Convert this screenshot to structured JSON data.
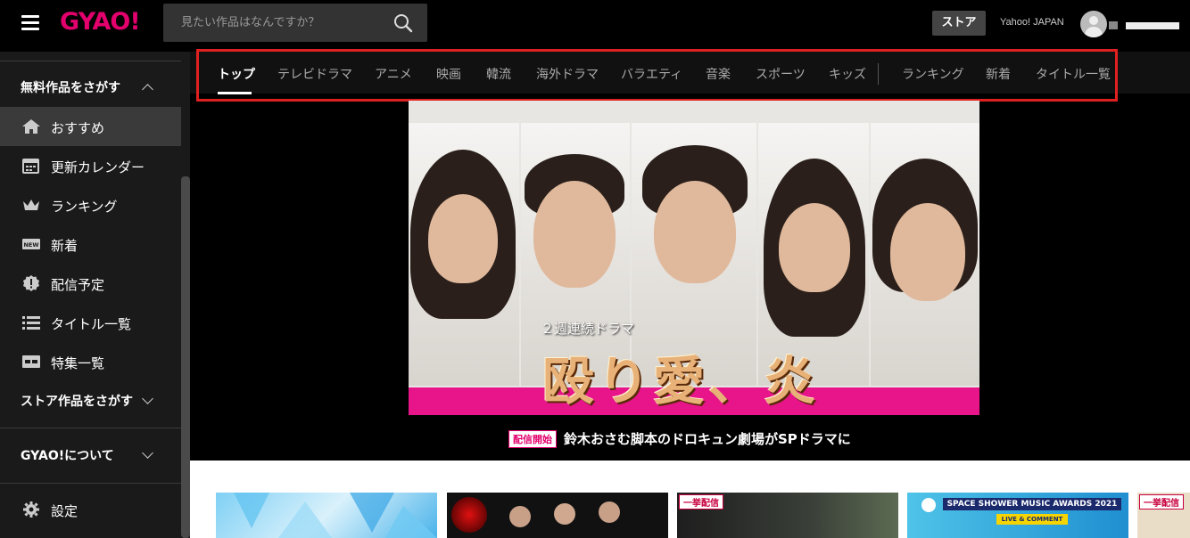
{
  "header": {
    "logo": "GYAO!",
    "search_placeholder": "見たい作品はなんですか？",
    "store_label": "ストア",
    "yahoo_label": "Yahoo! JAPAN"
  },
  "sidebar": {
    "free_section_label": "無料作品をさがす",
    "items": [
      {
        "label": "おすすめ",
        "icon": "home-icon"
      },
      {
        "label": "更新カレンダー",
        "icon": "calendar-icon"
      },
      {
        "label": "ランキング",
        "icon": "crown-icon"
      },
      {
        "label": "新着",
        "icon": "new-icon"
      },
      {
        "label": "配信予定",
        "icon": "alert-badge-icon"
      },
      {
        "label": "タイトル一覧",
        "icon": "list-icon"
      },
      {
        "label": "特集一覧",
        "icon": "feature-icon"
      }
    ],
    "store_section_label": "ストア作品をさがす",
    "about_label": "GYAO!について",
    "settings_label": "設定"
  },
  "tabs": [
    "トップ",
    "テレビドラマ",
    "アニメ",
    "映画",
    "韓流",
    "海外ドラマ",
    "バラエティ",
    "音楽",
    "スポーツ",
    "キッズ",
    "ランキング",
    "新着",
    "タイトル一覧"
  ],
  "hero": {
    "subtitle": "２週連続ドラマ",
    "title": "殴り愛、炎",
    "badge": "配信開始",
    "caption": "鈴木おさむ脚本のドロキュン劇場がSPドラマに"
  },
  "thumbnails": [
    {
      "tag": ""
    },
    {
      "tag": ""
    },
    {
      "tag": "一挙配信"
    },
    {
      "tag": "",
      "banner": "SPACE SHOWER MUSIC AWARDS 2021",
      "sub": "LIVE & COMMENT"
    },
    {
      "tag": "一挙配信"
    }
  ],
  "colors": {
    "brand": "#e3006d",
    "highlight_box": "#e02020",
    "hero_bar": "#e8148a"
  }
}
